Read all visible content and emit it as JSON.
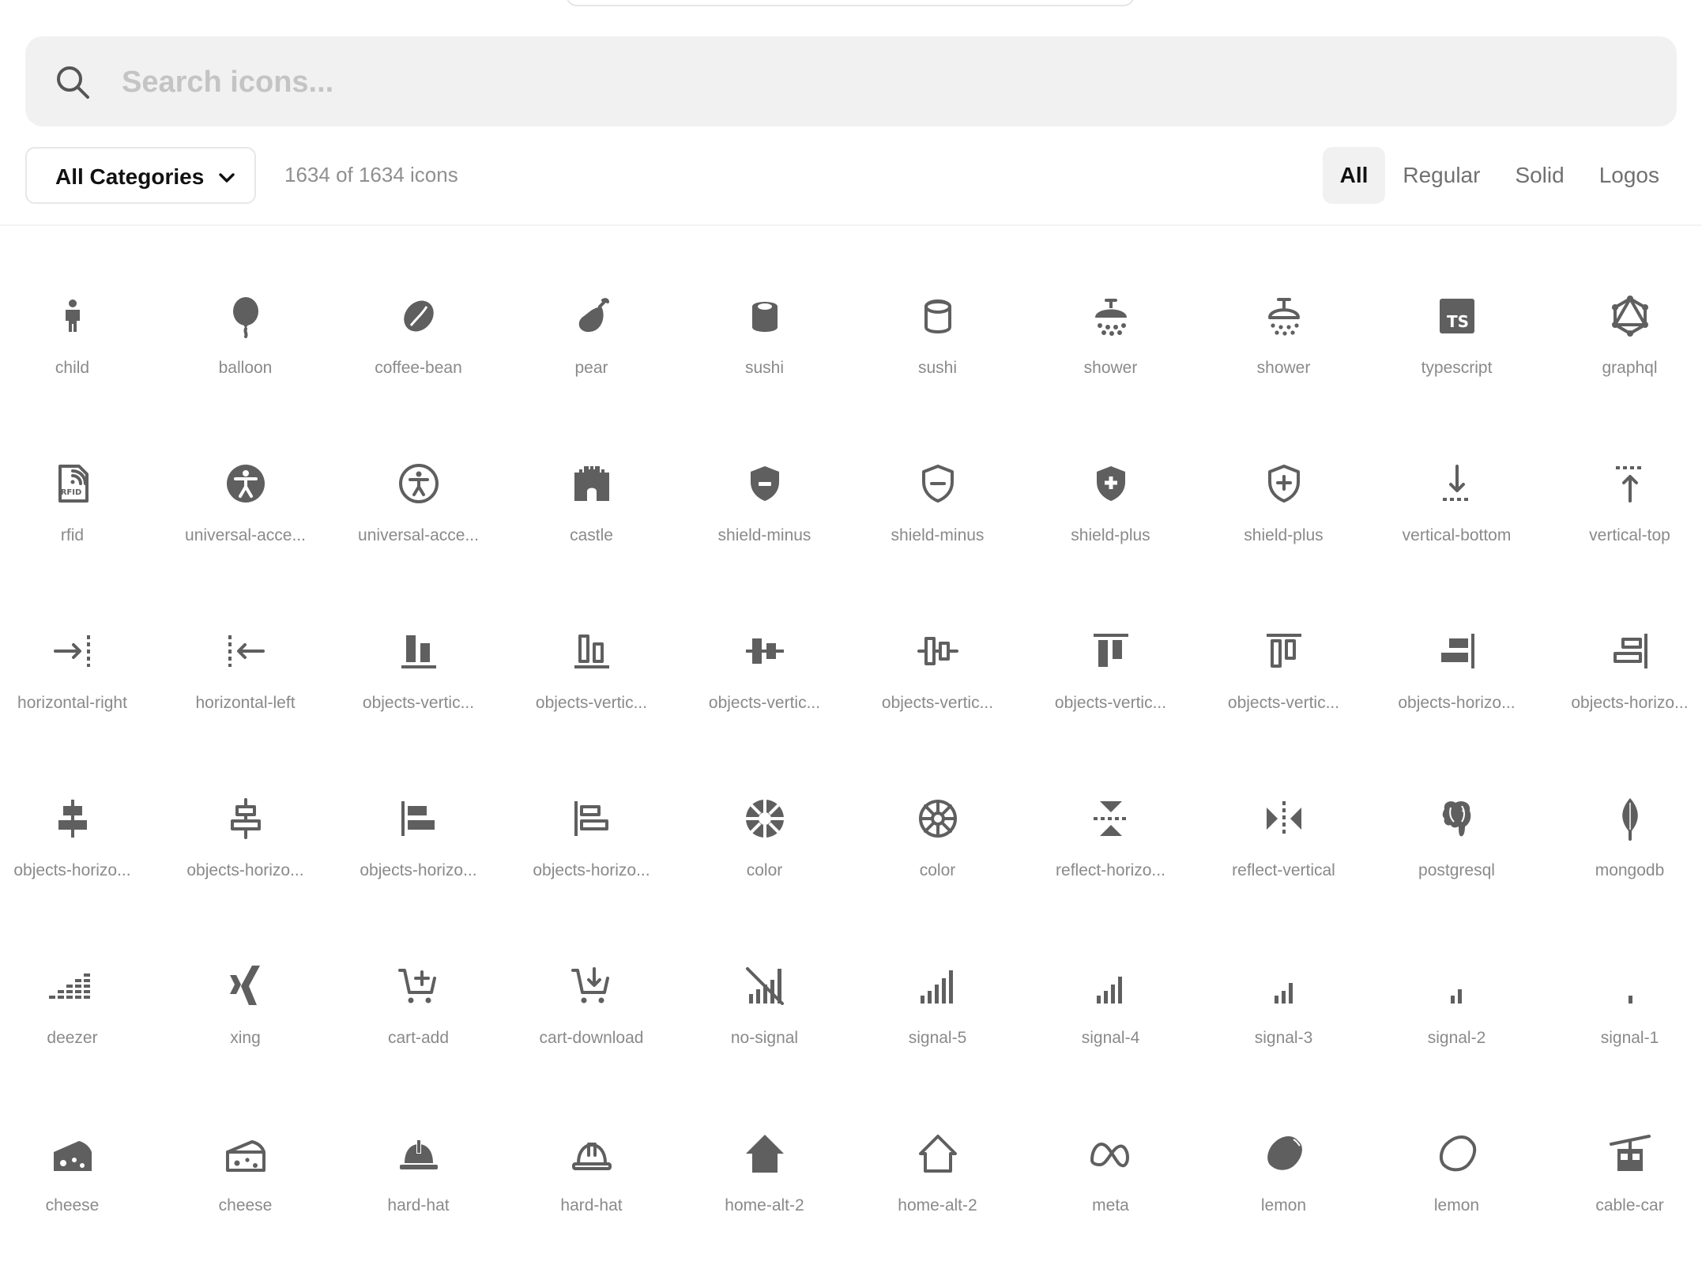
{
  "search": {
    "placeholder": "Search icons..."
  },
  "category_select": {
    "label": "All Categories"
  },
  "count_text": "1634 of 1634 icons",
  "filters": [
    "All",
    "Regular",
    "Solid",
    "Logos"
  ],
  "active_filter": "All",
  "icons": [
    {
      "name": "child",
      "icon": "child-icon"
    },
    {
      "name": "balloon",
      "icon": "balloon-icon"
    },
    {
      "name": "coffee-bean",
      "icon": "coffee-bean-icon"
    },
    {
      "name": "pear",
      "icon": "pear-icon"
    },
    {
      "name": "sushi",
      "icon": "sushi-solid-icon"
    },
    {
      "name": "sushi",
      "icon": "sushi-regular-icon"
    },
    {
      "name": "shower",
      "icon": "shower-solid-icon"
    },
    {
      "name": "shower",
      "icon": "shower-regular-icon"
    },
    {
      "name": "typescript",
      "icon": "typescript-icon"
    },
    {
      "name": "graphql",
      "icon": "graphql-icon"
    },
    {
      "name": "rfid",
      "icon": "rfid-icon"
    },
    {
      "name": "universal-acce...",
      "icon": "universal-access-solid-icon"
    },
    {
      "name": "universal-acce...",
      "icon": "universal-access-regular-icon"
    },
    {
      "name": "castle",
      "icon": "castle-icon"
    },
    {
      "name": "shield-minus",
      "icon": "shield-minus-solid-icon"
    },
    {
      "name": "shield-minus",
      "icon": "shield-minus-regular-icon"
    },
    {
      "name": "shield-plus",
      "icon": "shield-plus-solid-icon"
    },
    {
      "name": "shield-plus",
      "icon": "shield-plus-regular-icon"
    },
    {
      "name": "vertical-bottom",
      "icon": "vertical-bottom-icon"
    },
    {
      "name": "vertical-top",
      "icon": "vertical-top-icon"
    },
    {
      "name": "horizontal-right",
      "icon": "horizontal-right-icon"
    },
    {
      "name": "horizontal-left",
      "icon": "horizontal-left-icon"
    },
    {
      "name": "objects-vertic...",
      "icon": "objects-vertical-bottom-solid-icon"
    },
    {
      "name": "objects-vertic...",
      "icon": "objects-vertical-bottom-regular-icon"
    },
    {
      "name": "objects-vertic...",
      "icon": "objects-vertical-center-solid-icon"
    },
    {
      "name": "objects-vertic...",
      "icon": "objects-vertical-center-regular-icon"
    },
    {
      "name": "objects-vertic...",
      "icon": "objects-vertical-top-solid-icon"
    },
    {
      "name": "objects-vertic...",
      "icon": "objects-vertical-top-regular-icon"
    },
    {
      "name": "objects-horizo...",
      "icon": "objects-horizontal-right-solid-icon"
    },
    {
      "name": "objects-horizo...",
      "icon": "objects-horizontal-right-regular-icon"
    },
    {
      "name": "objects-horizo...",
      "icon": "objects-horizontal-center-solid-icon"
    },
    {
      "name": "objects-horizo...",
      "icon": "objects-horizontal-center-regular-icon"
    },
    {
      "name": "objects-horizo...",
      "icon": "objects-horizontal-left-solid-icon"
    },
    {
      "name": "objects-horizo...",
      "icon": "objects-horizontal-left-regular-icon"
    },
    {
      "name": "color",
      "icon": "color-solid-icon"
    },
    {
      "name": "color",
      "icon": "color-regular-icon"
    },
    {
      "name": "reflect-horizo...",
      "icon": "reflect-horizontal-icon"
    },
    {
      "name": "reflect-vertical",
      "icon": "reflect-vertical-icon"
    },
    {
      "name": "postgresql",
      "icon": "postgresql-icon"
    },
    {
      "name": "mongodb",
      "icon": "mongodb-icon"
    },
    {
      "name": "deezer",
      "icon": "deezer-icon"
    },
    {
      "name": "xing",
      "icon": "xing-icon"
    },
    {
      "name": "cart-add",
      "icon": "cart-add-icon"
    },
    {
      "name": "cart-download",
      "icon": "cart-download-icon"
    },
    {
      "name": "no-signal",
      "icon": "no-signal-icon"
    },
    {
      "name": "signal-5",
      "icon": "signal-5-icon"
    },
    {
      "name": "signal-4",
      "icon": "signal-4-icon"
    },
    {
      "name": "signal-3",
      "icon": "signal-3-icon"
    },
    {
      "name": "signal-2",
      "icon": "signal-2-icon"
    },
    {
      "name": "signal-1",
      "icon": "signal-1-icon"
    },
    {
      "name": "cheese",
      "icon": "cheese-solid-icon"
    },
    {
      "name": "cheese",
      "icon": "cheese-regular-icon"
    },
    {
      "name": "hard-hat",
      "icon": "hard-hat-solid-icon"
    },
    {
      "name": "hard-hat",
      "icon": "hard-hat-regular-icon"
    },
    {
      "name": "home-alt-2",
      "icon": "home-alt-2-solid-icon"
    },
    {
      "name": "home-alt-2",
      "icon": "home-alt-2-regular-icon"
    },
    {
      "name": "meta",
      "icon": "meta-icon"
    },
    {
      "name": "lemon",
      "icon": "lemon-solid-icon"
    },
    {
      "name": "lemon",
      "icon": "lemon-regular-icon"
    },
    {
      "name": "cable-car",
      "icon": "cable-car-icon"
    }
  ],
  "colors": {
    "icon": "#5f5f5f",
    "label": "#8a8a8a",
    "search_bg": "#f1f1f1",
    "text_dark": "#111111"
  }
}
